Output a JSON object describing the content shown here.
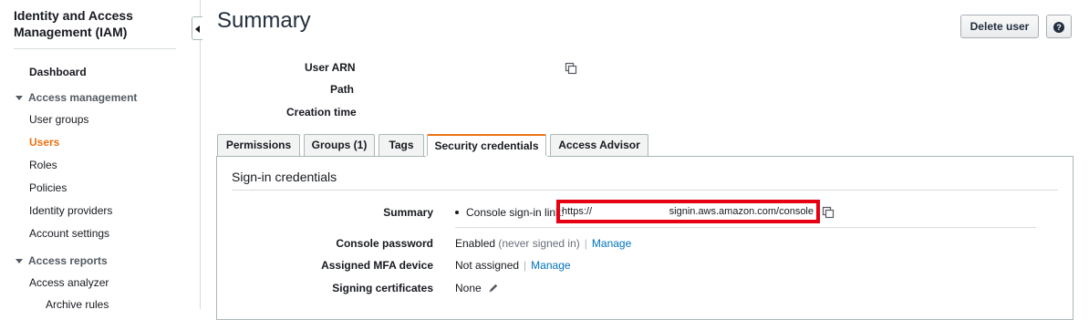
{
  "sidebar": {
    "title": "Identity and Access Management (IAM)",
    "dashboard": "Dashboard",
    "access_management": "Access management",
    "user_groups": "User groups",
    "users": "Users",
    "roles": "Roles",
    "policies": "Policies",
    "identity_providers": "Identity providers",
    "account_settings": "Account settings",
    "access_reports": "Access reports",
    "access_analyzer": "Access analyzer",
    "archive_rules": "Archive rules"
  },
  "header": {
    "title": "Summary",
    "delete_button": "Delete user",
    "help_button": "?"
  },
  "details": {
    "user_arn_label": "User ARN",
    "path_label": "Path",
    "creation_time_label": "Creation time"
  },
  "tabs": [
    {
      "label": "Permissions"
    },
    {
      "label": "Groups (1)"
    },
    {
      "label": "Tags"
    },
    {
      "label": "Security credentials"
    },
    {
      "label": "Access Advisor"
    }
  ],
  "signin": {
    "section_title": "Sign-in credentials",
    "summary_label": "Summary",
    "console_link_label": "Console sign-in link:",
    "url_prefix": "https://",
    "url_suffix": "signin.aws.amazon.com/console",
    "console_password_label": "Console password",
    "console_password_value": "Enabled",
    "console_password_note": "(never signed in)",
    "manage_label": "Manage",
    "mfa_label": "Assigned MFA device",
    "mfa_value": "Not assigned",
    "certs_label": "Signing certificates",
    "certs_value": "None"
  },
  "colors": {
    "accent_orange": "#ec7211",
    "link_blue": "#0073bb",
    "highlight_red": "#e60012"
  }
}
